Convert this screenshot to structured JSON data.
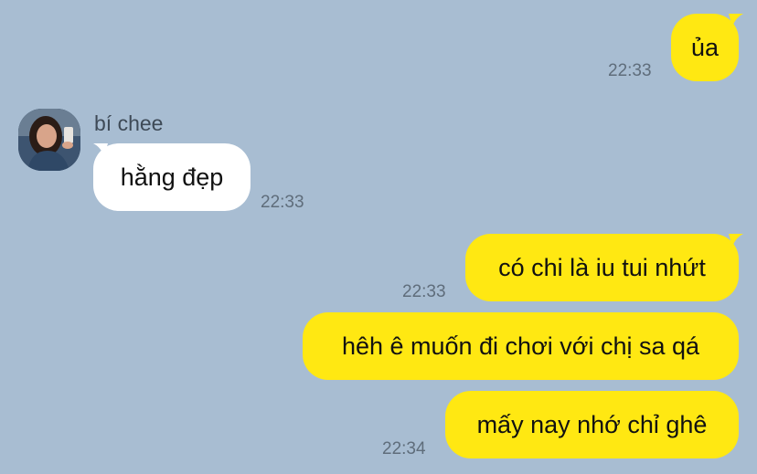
{
  "chat": {
    "background_color": "#a8bdd2",
    "outgoing_bubble_color": "#ffe812",
    "incoming_bubble_color": "#ffffff",
    "contact": {
      "name": "bí chee",
      "avatar": "profile-photo"
    },
    "messages": [
      {
        "direction": "outgoing",
        "text": "ủa",
        "time": "22:33"
      },
      {
        "direction": "incoming",
        "text": "hằng đẹp",
        "time": "22:33"
      },
      {
        "direction": "outgoing",
        "text": "có chi là iu tui nhứt",
        "time": "22:33"
      },
      {
        "direction": "outgoing",
        "text": "hêh ê muốn đi chơi với chị sa qá",
        "time": ""
      },
      {
        "direction": "outgoing",
        "text": "mấy nay nhớ chỉ ghê",
        "time": "22:34"
      }
    ]
  }
}
